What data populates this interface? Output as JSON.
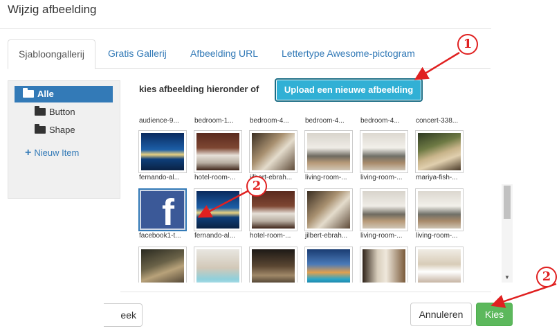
{
  "dialog": {
    "title": "Wijzig afbeelding"
  },
  "tabs": [
    {
      "label": "Sjabloongallerij"
    },
    {
      "label": "Gratis Gallerij"
    },
    {
      "label": "Afbeelding URL"
    },
    {
      "label": "Lettertype Awesome-pictogram"
    }
  ],
  "tree": {
    "items": [
      {
        "label": "Alle"
      },
      {
        "label": "Button"
      },
      {
        "label": "Shape"
      }
    ],
    "new_item": "Nieuw Item"
  },
  "gallery": {
    "prompt": "kies afbeelding hieronder of",
    "upload_label": "Upload een nieuwe afbeelding",
    "header_names": [
      "audience-9...",
      "bedroom-1...",
      "bedroom-4...",
      "bedroom-4...",
      "bedroom-4...",
      "concert-338..."
    ],
    "row1_captions": [
      "fernando-al...",
      "hotel-room-...",
      "jilbert-ebrah...",
      "living-room-...",
      "living-room-...",
      "mariya-fish-..."
    ],
    "row2_captions": [
      "facebook1-t...",
      "fernando-al...",
      "hotel-room-...",
      "jilbert-ebrah...",
      "living-room-...",
      "living-room-..."
    ],
    "facebook_glyph": "f"
  },
  "footer": {
    "back_label": "eek",
    "cancel_label": "Annuleren",
    "kies_label": "Kies"
  },
  "annotations": [
    "1",
    "2",
    "2"
  ],
  "colors": {
    "primary": "#337ab7",
    "info": "#31b0d5",
    "success": "#5cb85c",
    "annotation": "#e02020",
    "facebook": "#3b5998"
  }
}
